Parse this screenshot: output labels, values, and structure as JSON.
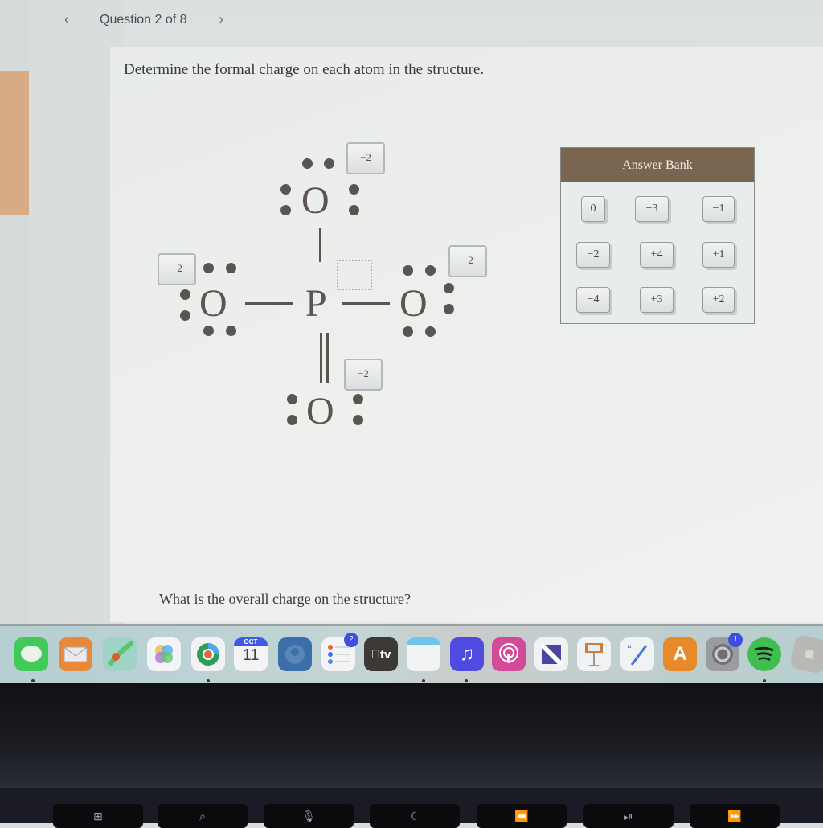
{
  "header": {
    "question_counter": "Question 2 of 8",
    "prev_icon": "‹",
    "next_icon": "›"
  },
  "question": {
    "prompt": "Determine the formal charge on each atom in the structure.",
    "followup": "What is the overall charge on the structure?"
  },
  "structure": {
    "central_atom": "P",
    "atoms": [
      {
        "symbol": "O",
        "position": "top",
        "bond": "single",
        "placed_charge": "−2"
      },
      {
        "symbol": "O",
        "position": "left",
        "bond": "single",
        "placed_charge": "−2"
      },
      {
        "symbol": "O",
        "position": "right",
        "bond": "single",
        "placed_charge": "−2"
      },
      {
        "symbol": "O",
        "position": "bottom",
        "bond": "double",
        "placed_charge": "−2"
      }
    ],
    "central_drop_target": ""
  },
  "answer_bank": {
    "title": "Answer Bank",
    "items": [
      "0",
      "−3",
      "−1",
      "−2",
      "+4",
      "+1",
      "−4",
      "+3",
      "+2"
    ]
  },
  "dock": {
    "apps": [
      {
        "name": "Messages",
        "icon": "messages-icon"
      },
      {
        "name": "Mail",
        "icon": "mail-icon"
      },
      {
        "name": "Maps",
        "icon": "maps-icon"
      },
      {
        "name": "Photos",
        "icon": "photos-icon"
      },
      {
        "name": "Chrome",
        "icon": "chrome-icon"
      },
      {
        "name": "Calendar",
        "icon": "calendar-icon",
        "month": "OCT",
        "day": "11"
      },
      {
        "name": "Contacts",
        "icon": "contacts-icon"
      },
      {
        "name": "Reminders",
        "icon": "reminders-icon",
        "badge": "2"
      },
      {
        "name": "TV",
        "icon": "tv-icon",
        "label": "tv"
      },
      {
        "name": "Notes",
        "icon": "notes-icon"
      },
      {
        "name": "Music",
        "icon": "music-icon"
      },
      {
        "name": "Podcasts",
        "icon": "podcasts-icon"
      },
      {
        "name": "News",
        "icon": "news-icon"
      },
      {
        "name": "Keynote",
        "icon": "keynote-icon"
      },
      {
        "name": "Pages",
        "icon": "pages-icon"
      },
      {
        "name": "App Store",
        "icon": "app-store-icon"
      },
      {
        "name": "System Preferences",
        "icon": "system-preferences-icon",
        "badge": "1"
      },
      {
        "name": "Spotify",
        "icon": "spotify-icon"
      },
      {
        "name": "Roblox",
        "icon": "roblox-icon"
      }
    ]
  },
  "touchbar": {
    "keys": [
      "⊞",
      "⌕",
      "🎙",
      "☾",
      "⏪",
      "⏯",
      "⏩"
    ]
  }
}
